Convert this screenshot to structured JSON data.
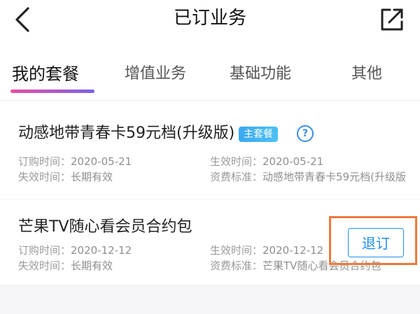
{
  "header": {
    "title": "已订业务",
    "back_icon": "chevron-left-icon",
    "share_icon": "share-external-icon"
  },
  "tabs": [
    {
      "label": "我的套餐",
      "active": true
    },
    {
      "label": "增值业务",
      "active": false
    },
    {
      "label": "基础功能",
      "active": false
    },
    {
      "label": "其他",
      "active": false
    }
  ],
  "packages": [
    {
      "name": "动感地带青春卡59元档(升级版)",
      "badge": "主套餐",
      "help": "?",
      "order_time_label": "订购时间：",
      "order_time": "2020-05-21",
      "effective_time_label": "生效时间：",
      "effective_time": "2020-05-21",
      "expire_time_label": "失效时间：",
      "expire_time": "长期有效",
      "fee_label": "资费标准：",
      "fee": "动感地带青春卡59元档(升级版"
    },
    {
      "name": "芒果TV随心看会员合约包",
      "order_time_label": "订购时间：",
      "order_time": "2020-12-12",
      "effective_time_label": "生效时间：",
      "effective_time": "2020-12-12",
      "expire_time_label": "失效时间：",
      "expire_time": "长期有效",
      "fee_label": "资费标准：",
      "fee": "芒果TV随心看会员合约包",
      "action_label": "退订"
    }
  ],
  "colors": {
    "accent_blue": "#1f8ee8",
    "badge_blue": "#3aa8f2",
    "tab_gradient_start": "#e84fa3",
    "tab_gradient_end": "#7b63e6",
    "highlight_orange": "#f0783c"
  }
}
